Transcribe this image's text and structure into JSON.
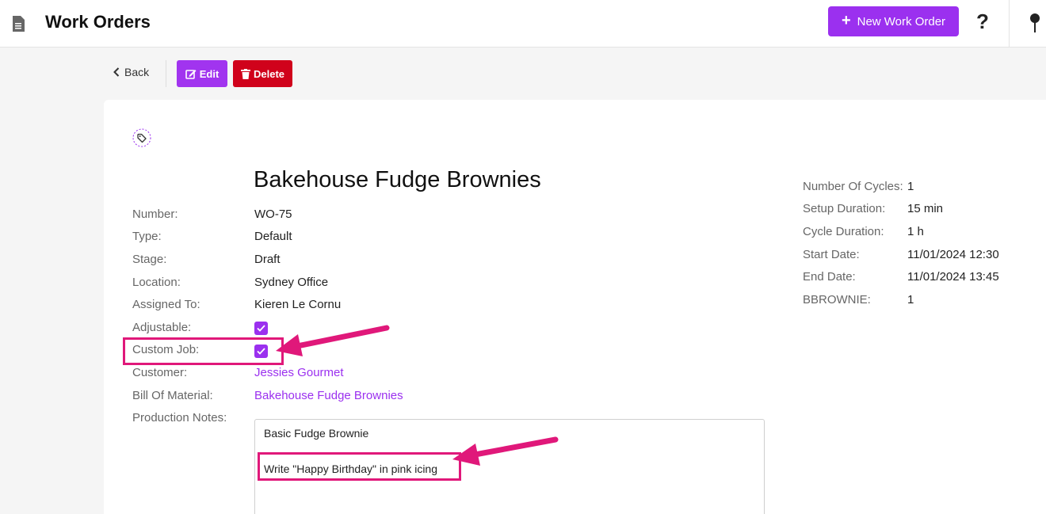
{
  "header": {
    "title": "Work Orders",
    "new_button_label": "New Work Order"
  },
  "toolbar": {
    "back_label": "Back",
    "edit_label": "Edit",
    "delete_label": "Delete"
  },
  "work_order": {
    "title": "Bakehouse Fudge Brownies",
    "fields": [
      {
        "label": "Number:",
        "value": "WO-75"
      },
      {
        "label": "Type:",
        "value": "Default"
      },
      {
        "label": "Stage:",
        "value": "Draft"
      },
      {
        "label": "Location:",
        "value": "Sydney Office"
      },
      {
        "label": "Assigned To:",
        "value": "Kieren Le Cornu"
      },
      {
        "label": "Adjustable:",
        "checked": true
      },
      {
        "label": "Custom Job:",
        "checked": true
      },
      {
        "label": "Customer:",
        "value": "Jessies Gourmet"
      },
      {
        "label": "Bill Of Material:",
        "value": "Bakehouse Fudge Brownies"
      },
      {
        "label": "Production Notes:"
      }
    ],
    "production_notes": [
      "Basic Fudge Brownie",
      "Write \"Happy Birthday\" in pink icing"
    ],
    "side_fields": [
      {
        "label": "Number Of Cycles:",
        "value": "1"
      },
      {
        "label": "Setup Duration:",
        "value": "15 min"
      },
      {
        "label": "Cycle Duration:",
        "value": "1 h"
      },
      {
        "label": "Start Date:",
        "value": "11/01/2024 12:30"
      },
      {
        "label": "End Date:",
        "value": "11/01/2024 13:45"
      },
      {
        "label": "BBROWNIE:",
        "value": "1"
      }
    ]
  },
  "colors": {
    "accent": "#9b30ef",
    "danger": "#d0021b",
    "highlight": "#e0187a"
  },
  "icons": [
    "document-icon",
    "plus-icon",
    "help-icon",
    "pin-icon",
    "chevron-left-icon",
    "edit-icon",
    "trash-icon",
    "tag-icon",
    "checkmark-icon",
    "arrow-annotation"
  ]
}
